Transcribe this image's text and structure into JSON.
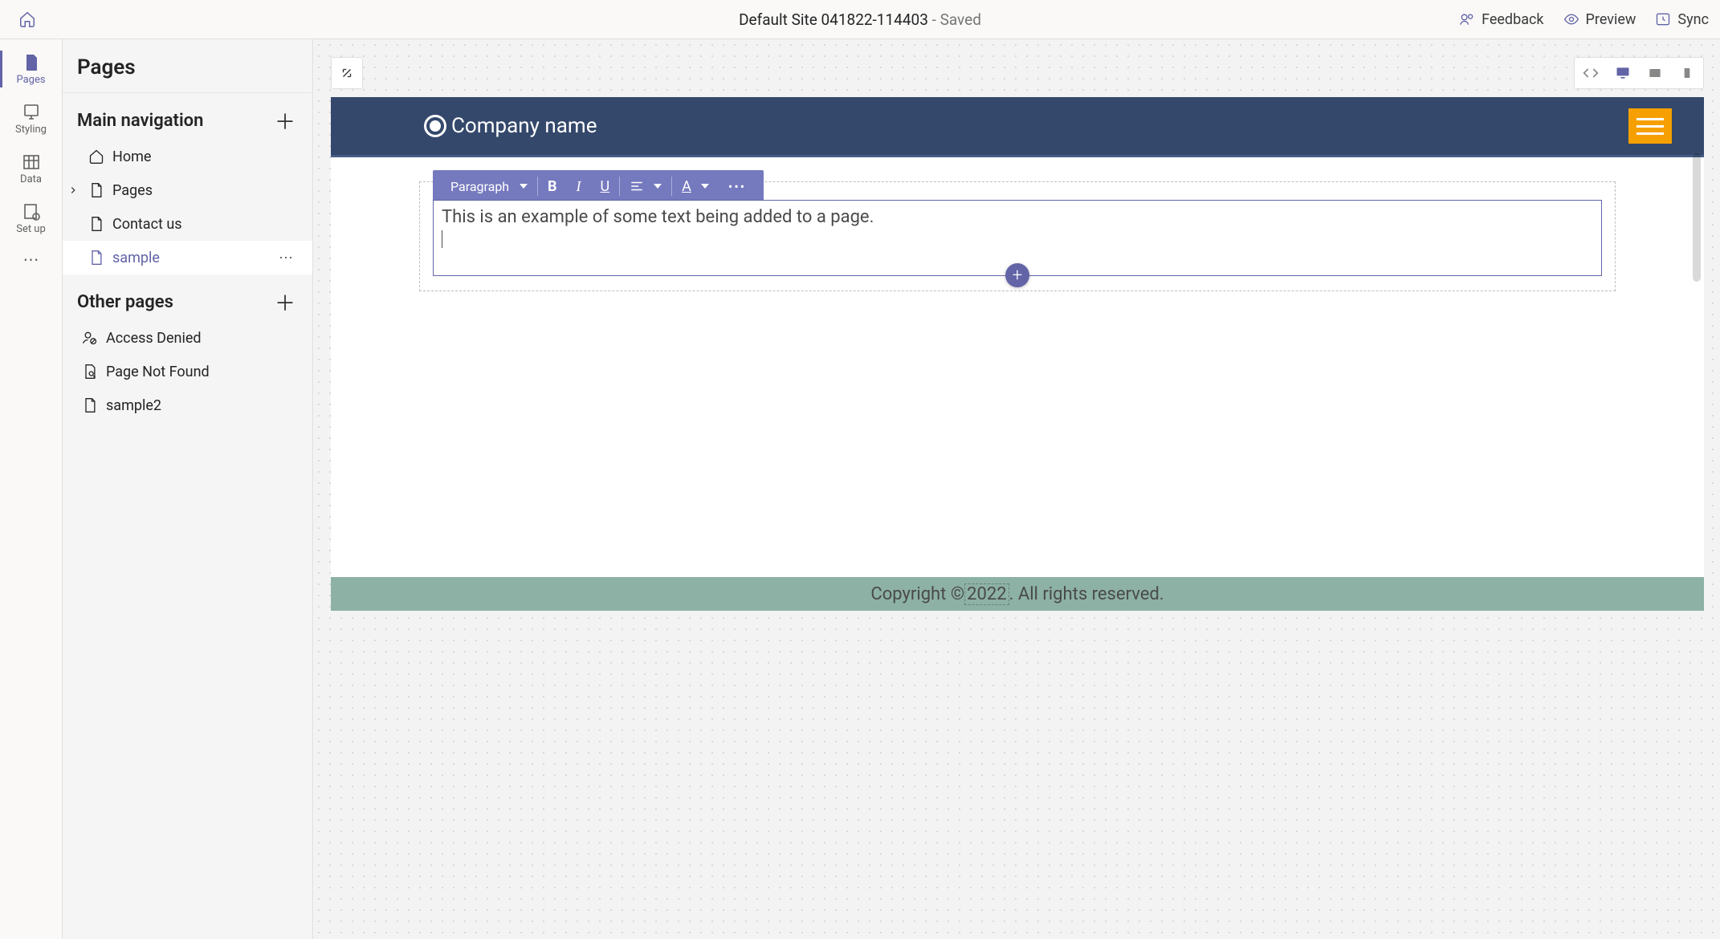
{
  "titlebar": {
    "site_name": "Default Site 041822-114403",
    "saved_label": "- Saved",
    "actions": {
      "feedback": "Feedback",
      "preview": "Preview",
      "sync": "Sync"
    }
  },
  "rail": {
    "pages": "Pages",
    "styling": "Styling",
    "data": "Data",
    "setup": "Set up"
  },
  "panel": {
    "title": "Pages",
    "sections": {
      "main_nav": "Main navigation",
      "other": "Other pages"
    },
    "main_nav_items": {
      "home": "Home",
      "pages": "Pages",
      "contact": "Contact us",
      "sample": "sample"
    },
    "other_items": {
      "access_denied": "Access Denied",
      "not_found": "Page Not Found",
      "sample2": "sample2"
    }
  },
  "editor": {
    "paragraph_label": "Paragraph"
  },
  "preview": {
    "company": "Company name",
    "body_text": "This is an example of some text being added to a page.",
    "footer_prefix": "Copyright © ",
    "footer_year": "2022",
    "footer_suffix": ". All rights reserved."
  }
}
